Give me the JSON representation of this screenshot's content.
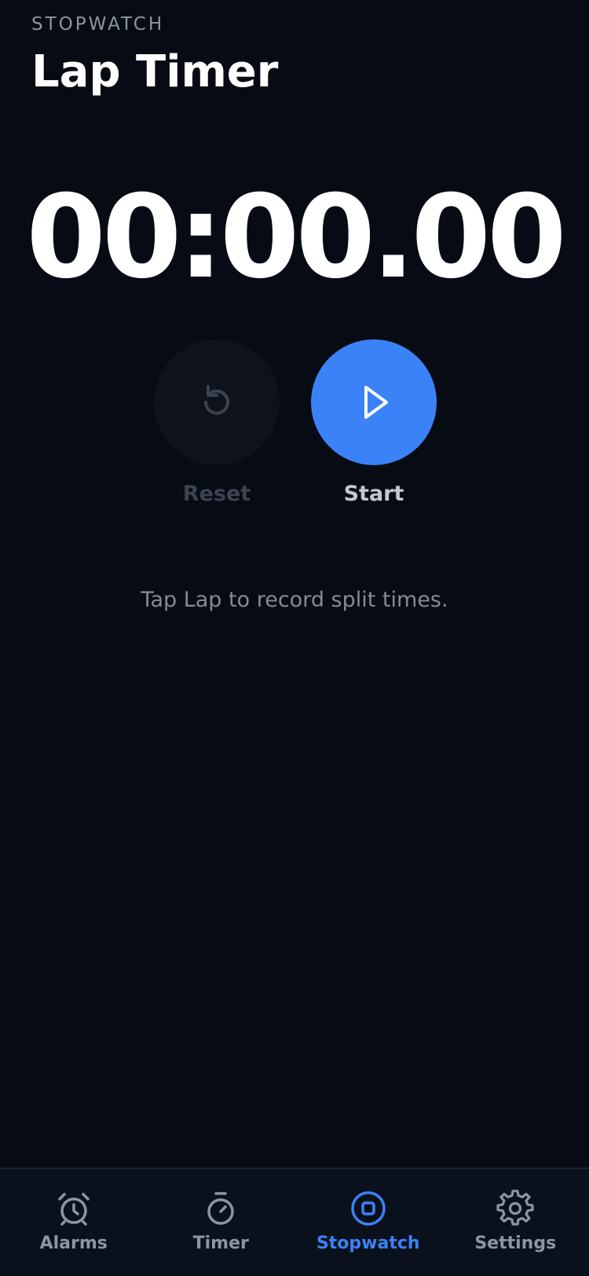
{
  "header": {
    "eyebrow": "STOPWATCH",
    "title": "Lap Timer"
  },
  "stopwatch": {
    "time": "00:00.00",
    "hint": "Tap Lap to record split times."
  },
  "controls": {
    "reset": {
      "label": "Reset",
      "icon": "reset-icon",
      "enabled": false
    },
    "start": {
      "label": "Start",
      "icon": "play-icon",
      "enabled": true
    }
  },
  "tabs": [
    {
      "label": "Alarms",
      "icon": "alarm-clock-icon",
      "active": false
    },
    {
      "label": "Timer",
      "icon": "timer-icon",
      "active": false
    },
    {
      "label": "Stopwatch",
      "icon": "stopwatch-icon",
      "active": true
    },
    {
      "label": "Settings",
      "icon": "gear-icon",
      "active": false
    }
  ],
  "colors": {
    "background": "#070b14",
    "accent": "#3b82f6",
    "muted_text": "#8d95a3",
    "disabled_text": "#3c4350"
  }
}
